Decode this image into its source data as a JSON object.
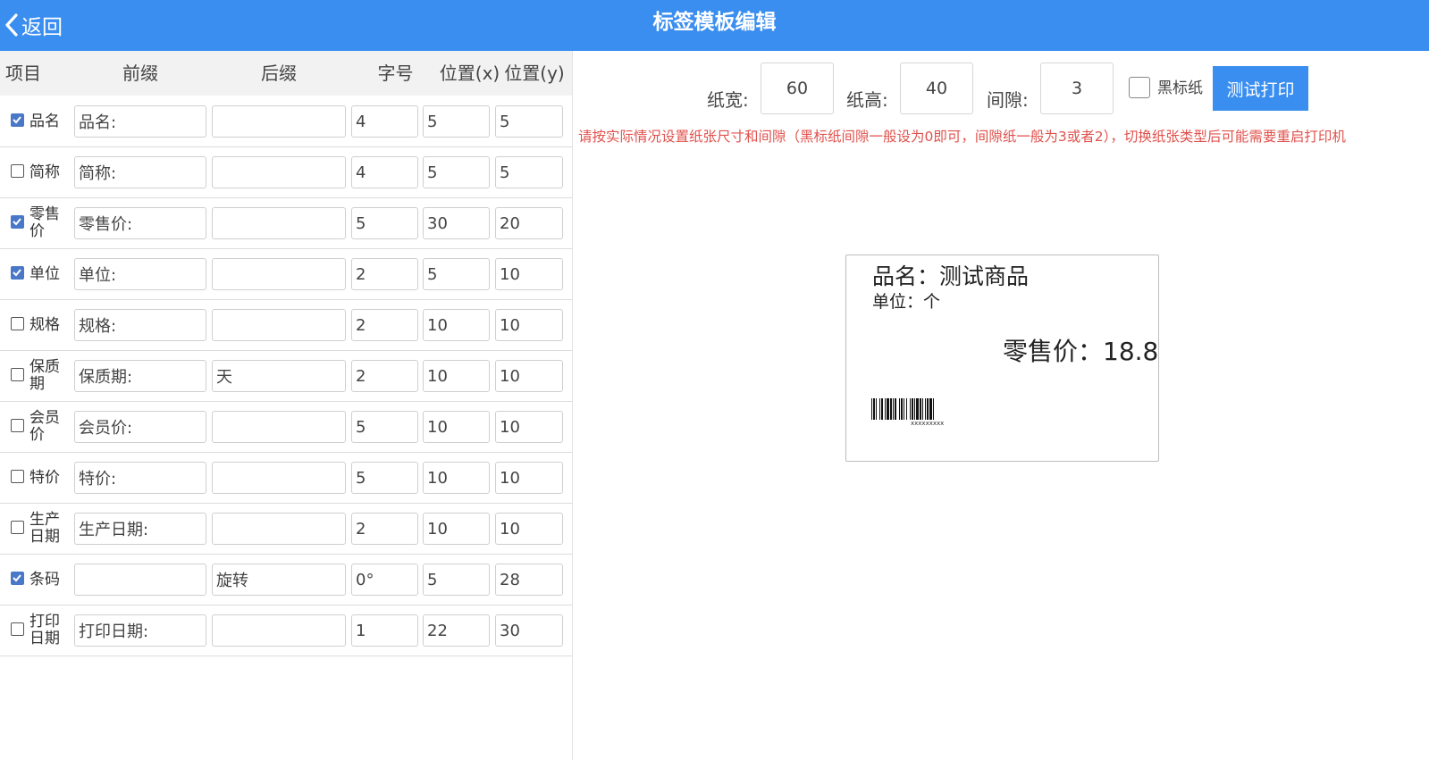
{
  "header": {
    "back_label": "返回",
    "title": "标签模板编辑"
  },
  "table": {
    "columns": [
      "项目",
      "前缀",
      "后缀",
      "字号",
      "位置(x)",
      "位置(y)"
    ],
    "rows": [
      {
        "label": "品名",
        "checked": true,
        "prefix": "品名:",
        "suffix": "",
        "size": "4",
        "x": "5",
        "y": "5"
      },
      {
        "label": "简称",
        "checked": false,
        "prefix": "简称:",
        "suffix": "",
        "size": "4",
        "x": "5",
        "y": "5"
      },
      {
        "label": "零售价",
        "checked": true,
        "prefix": "零售价:",
        "suffix": "",
        "size": "5",
        "x": "30",
        "y": "20"
      },
      {
        "label": "单位",
        "checked": true,
        "prefix": "单位:",
        "suffix": "",
        "size": "2",
        "x": "5",
        "y": "10"
      },
      {
        "label": "规格",
        "checked": false,
        "prefix": "规格:",
        "suffix": "",
        "size": "2",
        "x": "10",
        "y": "10"
      },
      {
        "label": "保质期",
        "checked": false,
        "prefix": "保质期:",
        "suffix": "天",
        "size": "2",
        "x": "10",
        "y": "10"
      },
      {
        "label": "会员价",
        "checked": false,
        "prefix": "会员价:",
        "suffix": "",
        "size": "5",
        "x": "10",
        "y": "10"
      },
      {
        "label": "特价",
        "checked": false,
        "prefix": "特价:",
        "suffix": "",
        "size": "5",
        "x": "10",
        "y": "10"
      },
      {
        "label": "生产日期",
        "checked": false,
        "prefix": "生产日期:",
        "suffix": "",
        "size": "2",
        "x": "10",
        "y": "10"
      },
      {
        "label": "条码",
        "checked": true,
        "prefix": "",
        "suffix": "旋转",
        "size": "0°",
        "x": "5",
        "y": "28"
      },
      {
        "label": "打印日期",
        "checked": false,
        "prefix": "打印日期:",
        "suffix": "",
        "size": "1",
        "x": "22",
        "y": "30"
      }
    ]
  },
  "settings": {
    "width_label": "纸宽:",
    "width_value": "60",
    "height_label": "纸高:",
    "height_value": "40",
    "gap_label": "间隙:",
    "gap_value": "3",
    "black_label": "黑标纸",
    "black_checked": false,
    "test_button": "测试打印",
    "notice": "请按实际情况设置纸张尺寸和间隙（黑标纸间隙一般设为0即可，间隙纸一般为3或者2），切换纸张类型后可能需要重启打印机"
  },
  "preview": {
    "name_line": "品名：测试商品",
    "unit_line": "单位：个",
    "price_line": "零售价：18.8",
    "barcode_text": "xxxxxxxxx"
  },
  "colors": {
    "header_bg": "#3a8ef0",
    "checkbox_checked": "#4a78c8",
    "notice": "#e0524d"
  }
}
